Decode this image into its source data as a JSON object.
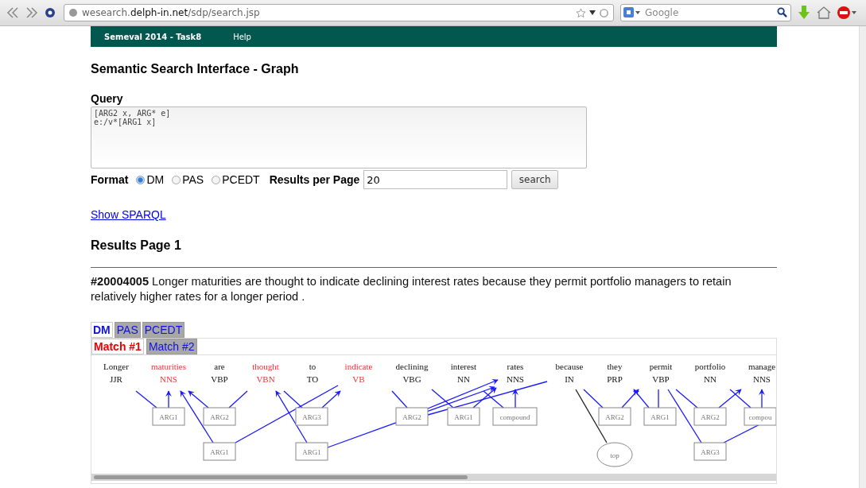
{
  "browser": {
    "url": "wesearch.**delph-in.net**/sdp/search.jsp",
    "search": {
      "placeholder": "Google"
    }
  },
  "nav": [
    "Semeval 2014 - Task8",
    "Help"
  ],
  "title": "Semantic Search Interface - Graph",
  "query": {
    "label": "Query",
    "value": "[ARG2 x, ARG* e]\ne:/v*[ARG1 x]"
  },
  "format": {
    "label": "Format",
    "options": [
      {
        "label": "DM",
        "selected": true
      },
      {
        "label": "PAS",
        "selected": false
      },
      {
        "label": "PCEDT",
        "selected": false
      }
    ]
  },
  "results_per_page": {
    "label": "Results per Page",
    "value": "20"
  },
  "search_button": "search",
  "show_sparql": "Show SPARQL",
  "results_title": "Results Page 1",
  "result": {
    "id": "#20004005",
    "sentence": "Longer maturities are thought to indicate declining interest rates because they permit portfolio managers to retain relatively higher rates for a longer period ."
  },
  "format_tabs": [
    {
      "label": "DM",
      "selected": true
    },
    {
      "label": "PAS",
      "selected": false
    },
    {
      "label": "PCEDT",
      "selected": false
    }
  ],
  "match_tabs": [
    {
      "label": "Match #1",
      "selected": true
    },
    {
      "label": "Match #2",
      "selected": false
    }
  ],
  "tokens": [
    {
      "word": "Longer",
      "tag": "JJR",
      "matched": false
    },
    {
      "word": "maturities",
      "tag": "NNS",
      "matched": true
    },
    {
      "word": "are",
      "tag": "VBP",
      "matched": false
    },
    {
      "word": "thought",
      "tag": "VBN",
      "matched": true
    },
    {
      "word": "to",
      "tag": "TO",
      "matched": false
    },
    {
      "word": "indicate",
      "tag": "VB",
      "matched": true
    },
    {
      "word": "declining",
      "tag": "VBG",
      "matched": false
    },
    {
      "word": "interest",
      "tag": "NN",
      "matched": false
    },
    {
      "word": "rates",
      "tag": "NNS",
      "matched": false
    },
    {
      "word": "because",
      "tag": "IN",
      "matched": false
    },
    {
      "word": "they",
      "tag": "PRP",
      "matched": false
    },
    {
      "word": "permit",
      "tag": "VBP",
      "matched": false
    },
    {
      "word": "portfolio",
      "tag": "NN",
      "matched": false
    },
    {
      "word": "manage",
      "tag": "NNS",
      "matched": false
    }
  ],
  "nodes": [
    {
      "label": "ARG1",
      "kind": "box"
    },
    {
      "label": "ARG2",
      "kind": "box"
    },
    {
      "label": "ARG3",
      "kind": "box"
    },
    {
      "label": "ARG2",
      "kind": "box"
    },
    {
      "label": "ARG1",
      "kind": "box"
    },
    {
      "label": "compound",
      "kind": "box"
    },
    {
      "label": "ARG2",
      "kind": "box"
    },
    {
      "label": "ARG1",
      "kind": "box"
    },
    {
      "label": "ARG2",
      "kind": "box"
    },
    {
      "label": "compou",
      "kind": "box"
    },
    {
      "label": "ARG1",
      "kind": "box"
    },
    {
      "label": "ARG1",
      "kind": "box"
    },
    {
      "label": "top",
      "kind": "ellipse"
    },
    {
      "label": "ARG3",
      "kind": "box"
    }
  ]
}
